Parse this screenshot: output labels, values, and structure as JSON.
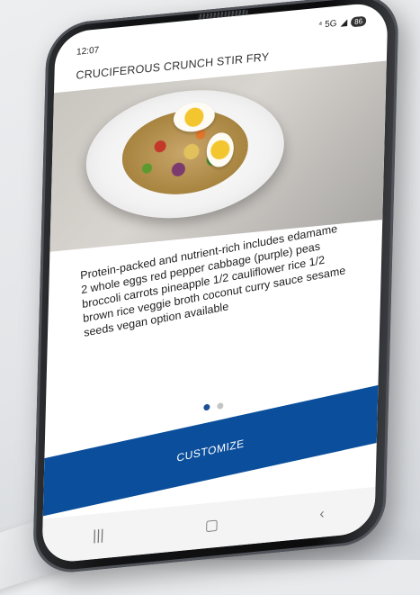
{
  "status": {
    "time": "12:07",
    "signal": "⁴ 5G",
    "battery": "86"
  },
  "dish": {
    "title": "CRUCIFEROUS CRUNCH STIR FRY",
    "description": "Protein-packed and nutrient-rich includes edamame 2 whole eggs red pepper cabbage (purple) peas broccoli carrots pineapple 1/2 cauliflower rice 1/2 brown rice veggie broth coconut curry sauce sesame seeds vegan option available"
  },
  "carousel": {
    "page_count": 2,
    "active_index": 0
  },
  "action": {
    "customize_label": "CUSTOMIZE"
  },
  "nav": {
    "recents_icon": "recents-icon",
    "home_icon": "home-icon",
    "back_icon": "back-icon"
  },
  "colors": {
    "accent": "#0b4f9c",
    "dot_active": "#1f4f97",
    "dot_inactive": "#c5c5c5"
  }
}
